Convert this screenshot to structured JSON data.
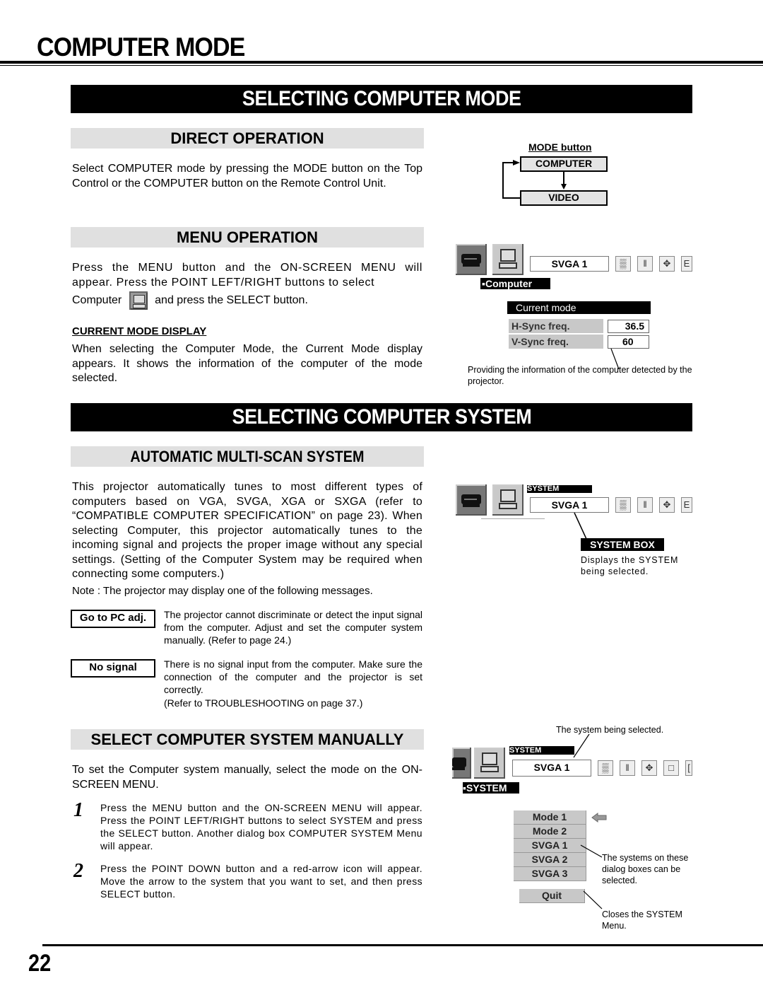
{
  "page": {
    "title": "COMPUTER MODE",
    "number": "22"
  },
  "section1": {
    "banner": "SELECTING COMPUTER MODE",
    "direct": {
      "heading": "DIRECT OPERATION",
      "text": "Select COMPUTER mode by pressing the MODE button on the Top Control or the COMPUTER button on the Remote Control Unit.",
      "diagram": {
        "label": "MODE button",
        "box1": "COMPUTER",
        "box2": "VIDEO"
      }
    },
    "menu": {
      "heading": "MENU OPERATION",
      "text_a": "Press the MENU button and the ON-SCREEN MENU will appear.  Press the POINT LEFT/RIGHT buttons to select",
      "text_b_before": "Computer",
      "text_b_after": "and press the SELECT button.",
      "subheading": "CURRENT MODE DISPLAY",
      "subtext": "When selecting the Computer Mode, the Current Mode display appears.  It shows the information of the computer of the mode selected.",
      "screen": {
        "system_value": "SVGA 1",
        "tag": "Computer",
        "current_mode_title": "Current mode",
        "rows": [
          {
            "label": "H-Sync freq.",
            "value": "36.5"
          },
          {
            "label": "V-Sync freq.",
            "value": "60"
          }
        ],
        "caption": "Providing the information of the computer detected by the projector."
      }
    }
  },
  "section2": {
    "banner": "SELECTING COMPUTER SYSTEM",
    "auto": {
      "heading": "AUTOMATIC MULTI-SCAN SYSTEM",
      "text": "This projector automatically tunes to most different types of computers based on VGA, SVGA, XGA or SXGA (refer to “COMPATIBLE COMPUTER SPECIFICATION” on page 23). When selecting Computer, this projector automatically tunes to the incoming signal and projects the proper image without any special settings.  (Setting of the Computer System may be required when connecting some computers.)",
      "note": "Note : The projector may display one of  the following messages.",
      "messages": [
        {
          "label": "Go to PC adj.",
          "text": "The projector cannot discriminate or detect the input signal from the computer.  Adjust and set the computer system manually.  (Refer to page 24.)"
        },
        {
          "label": "No signal",
          "text": "There is no signal input from the computer.  Make sure the connection of the computer and the projector is set correctly.",
          "text2": "(Refer to TROUBLESHOOTING on page 37.)"
        }
      ],
      "screen": {
        "system_tag": "SYSTEM",
        "system_value": "SVGA 1",
        "callout_label": "SYSTEM BOX",
        "callout_text": "Displays the SYSTEM being selected."
      }
    },
    "manual": {
      "heading": "SELECT COMPUTER SYSTEM MANUALLY",
      "intro": "To set the Computer system manually, select the mode on the ON-SCREEN MENU.",
      "steps": [
        {
          "num": "1",
          "text": "Press the MENU button and the ON-SCREEN MENU will appear.  Press the POINT LEFT/RIGHT buttons to select SYSTEM and press the SELECT button.  Another dialog box COMPUTER SYSTEM Menu will appear."
        },
        {
          "num": "2",
          "text": "Press the POINT DOWN button and a red-arrow icon will appear.  Move the arrow to the system that you want to set, and then press SELECT button."
        }
      ],
      "screen": {
        "caption_top": "The system being selected.",
        "system_tag": "SYSTEM",
        "system_value": "SVGA 1",
        "menu_tag": "SYSTEM",
        "menu_items": [
          "Mode 1",
          "Mode 2",
          "SVGA 1",
          "SVGA 2",
          "SVGA 3"
        ],
        "quit": "Quit",
        "caption_items": "The systems on these dialog boxes can be selected.",
        "caption_quit": "Closes the SYSTEM Menu."
      }
    }
  }
}
